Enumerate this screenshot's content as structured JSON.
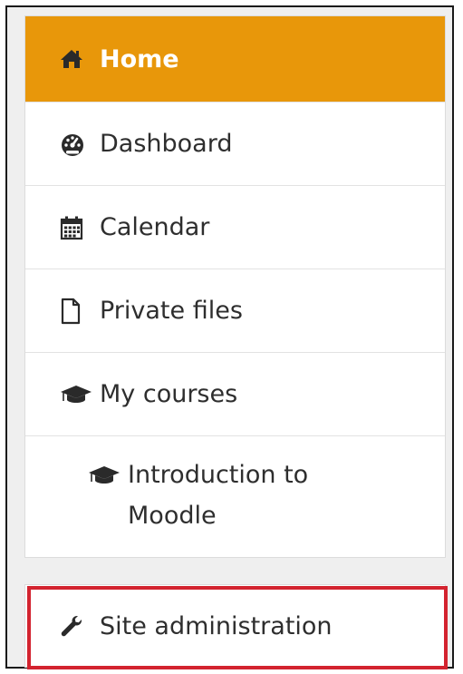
{
  "nav": {
    "items": [
      {
        "label": "Home",
        "icon": "home-icon",
        "active": true
      },
      {
        "label": "Dashboard",
        "icon": "dashboard-icon"
      },
      {
        "label": "Calendar",
        "icon": "calendar-icon"
      },
      {
        "label": "Private files",
        "icon": "file-icon"
      },
      {
        "label": "My courses",
        "icon": "graduation-cap-icon"
      },
      {
        "label": "Introduction to Moodle",
        "icon": "graduation-cap-icon"
      }
    ]
  },
  "admin": {
    "label": "Site administration",
    "icon": "wrench-icon"
  },
  "colors": {
    "active_bg": "#e8970a",
    "highlight": "#d3232f",
    "text": "#2e2e2e"
  }
}
